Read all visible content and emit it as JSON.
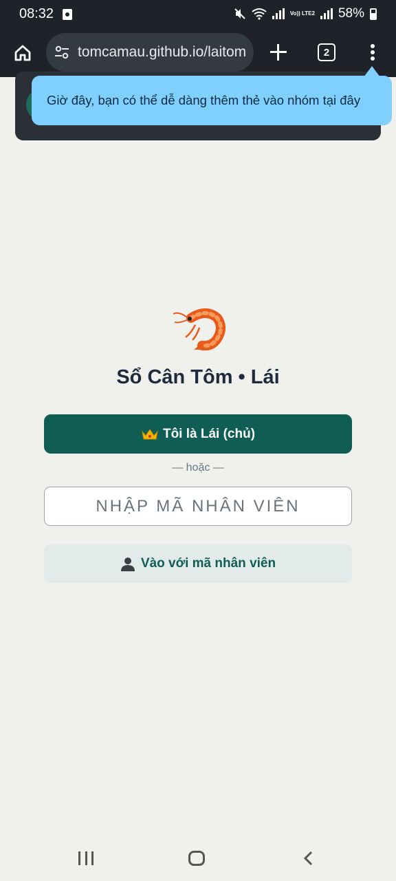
{
  "status_bar": {
    "time": "08:32",
    "battery": "58%",
    "lte_label": "Vo)) LTE2"
  },
  "browser": {
    "url": "tomcamau.github.io/laitom",
    "tab_count": "2"
  },
  "tooltip": {
    "text": "Giờ đây, bạn có thể dễ dàng thêm thẻ vào nhóm tại đây"
  },
  "app": {
    "title": "Sổ Cân Tôm • Lái",
    "owner_button_label": "Tôi là Lái (chủ)",
    "divider_text": "— hoặc —",
    "employee_code_placeholder": "NHẬP MÃ NHÂN VIÊN",
    "staff_button_label": "Vào với mã nhân viên"
  },
  "icons": {
    "logo": "shrimp-icon",
    "owner": "crown-icon",
    "staff": "person-icon"
  },
  "colors": {
    "primary": "#0f5d54",
    "secondary_bg": "#e3ebea",
    "tooltip_bg": "#7fd0ff",
    "page_bg": "#f0f0ec"
  }
}
